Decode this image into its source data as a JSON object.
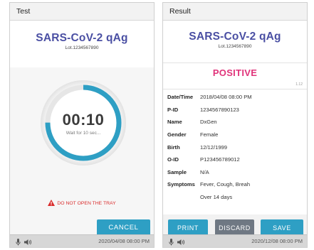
{
  "test_screen": {
    "title": "Test",
    "product": "SARS-CoV-2 qAg",
    "lot": "Lot.1234567890",
    "timer": "00:10",
    "timer_progress": 0.75,
    "wait_text": "Wait for 10 sec...",
    "warning": "DO NOT OPEN THE TRAY",
    "cancel_label": "CANCEL",
    "status_time": "2020/04/08 08:00 PM"
  },
  "result_screen": {
    "title": "Result",
    "product": "SARS-CoV-2 qAg",
    "lot": "Lot.1234567890",
    "result": "POSITIVE",
    "version": "1.12",
    "details": [
      {
        "label": "Date/Time",
        "value": "2018/04/08 08:00 PM"
      },
      {
        "label": "P-ID",
        "value": "1234567890123"
      },
      {
        "label": "Name",
        "value": "DxGen"
      },
      {
        "label": "Gender",
        "value": "Female"
      },
      {
        "label": "Birth",
        "value": "12/12/1999"
      },
      {
        "label": "O-ID",
        "value": "P123456789012"
      },
      {
        "label": "Sample",
        "value": "N/A"
      },
      {
        "label": "Symptoms",
        "value": "Fever, Cough, Breah"
      },
      {
        "label": "",
        "value": "Over 14 days"
      }
    ],
    "print_label": "PRINT",
    "discard_label": "DISCARD",
    "save_label": "SAVE",
    "status_time": "2020/12/08 08:00 PM"
  },
  "icons": {
    "mic": "microphone-icon",
    "speaker": "speaker-icon",
    "warning": "warning-triangle-icon"
  },
  "colors": {
    "product": "#4a4fa3",
    "accent": "#2e9fc4",
    "positive": "#e0337a",
    "warning": "#d92c2c",
    "discard": "#6f7883"
  }
}
